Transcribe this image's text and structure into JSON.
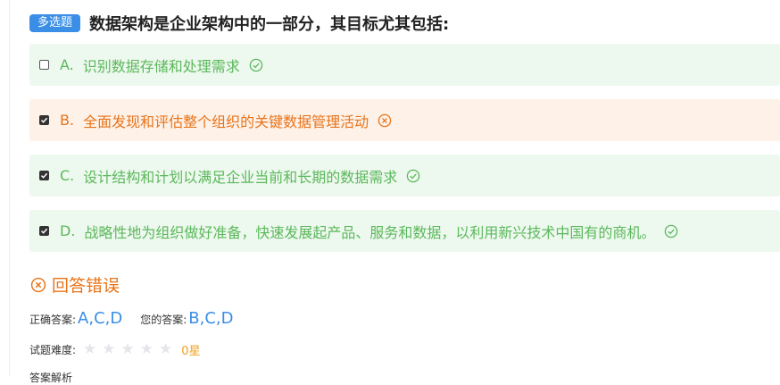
{
  "question": {
    "type_badge": "多选题",
    "text": "数据架构是企业架构中的一部分，其目标尤其包括:"
  },
  "options": [
    {
      "letter": "A.",
      "text": "识别数据存储和处理需求",
      "checked": false,
      "status": "correct"
    },
    {
      "letter": "B.",
      "text": "全面发现和评估整个组织的关键数据管理活动",
      "checked": true,
      "status": "wrong"
    },
    {
      "letter": "C.",
      "text": "设计结构和计划以满足企业当前和长期的数据需求",
      "checked": true,
      "status": "correct"
    },
    {
      "letter": "D.",
      "text": "战略性地为组织做好准备，快速发展起产品、服务和数据，以利用新兴技术中国有的商机。",
      "checked": true,
      "status": "correct"
    }
  ],
  "result": {
    "text": "回答错误",
    "correct_label": "正确答案:",
    "correct_value": "A,C,D",
    "your_label": "您的答案:",
    "your_value": "B,C,D",
    "difficulty_label": "试题难度:",
    "difficulty_stars": 0,
    "difficulty_max": 5,
    "difficulty_text": "0星",
    "analysis_label": "答案解析"
  },
  "colors": {
    "correct": "#5cb85c",
    "wrong": "#e8741a",
    "badge": "#3a8ee6",
    "answer_value": "#3a8ee6",
    "rating": "#f0a020"
  }
}
